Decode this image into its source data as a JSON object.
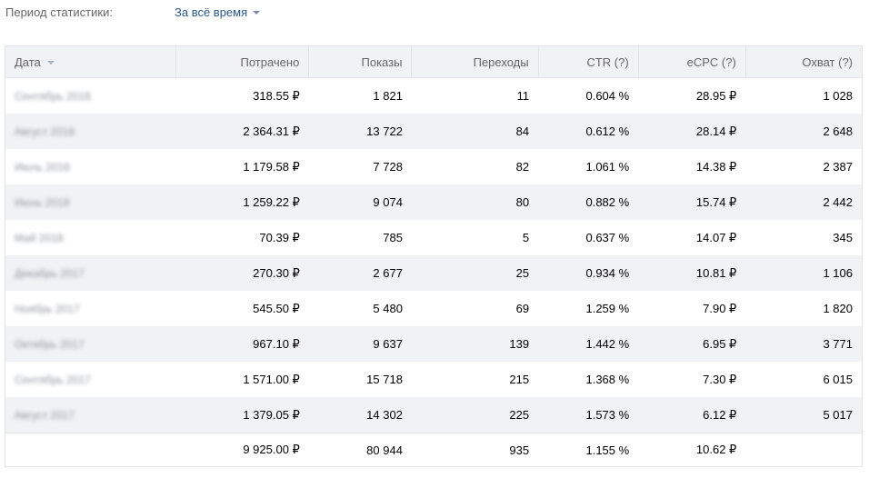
{
  "period": {
    "label": "Период статистики:",
    "value": "За всё время"
  },
  "table": {
    "columns": {
      "date": "Дата",
      "spent": "Потрачено",
      "impressions": "Показы",
      "clicks": "Переходы",
      "ctr": "CTR (?)",
      "ecpc": "eCPC (?)",
      "reach": "Охват (?)"
    },
    "rows": [
      {
        "date": "Сентябрь 2018",
        "spent": "318.55 ₽",
        "impressions": "1 821",
        "clicks": "11",
        "ctr": "0.604 %",
        "ecpc": "28.95 ₽",
        "reach": "1 028"
      },
      {
        "date": "Август 2018",
        "spent": "2 364.31 ₽",
        "impressions": "13 722",
        "clicks": "84",
        "ctr": "0.612 %",
        "ecpc": "28.14 ₽",
        "reach": "2 648"
      },
      {
        "date": "Июль 2018",
        "spent": "1 179.58 ₽",
        "impressions": "7 728",
        "clicks": "82",
        "ctr": "1.061 %",
        "ecpc": "14.38 ₽",
        "reach": "2 387"
      },
      {
        "date": "Июнь 2018",
        "spent": "1 259.22 ₽",
        "impressions": "9 074",
        "clicks": "80",
        "ctr": "0.882 %",
        "ecpc": "15.74 ₽",
        "reach": "2 442"
      },
      {
        "date": "Май 2018",
        "spent": "70.39 ₽",
        "impressions": "785",
        "clicks": "5",
        "ctr": "0.637 %",
        "ecpc": "14.07 ₽",
        "reach": "345"
      },
      {
        "date": "Декабрь 2017",
        "spent": "270.30 ₽",
        "impressions": "2 677",
        "clicks": "25",
        "ctr": "0.934 %",
        "ecpc": "10.81 ₽",
        "reach": "1 106"
      },
      {
        "date": "Ноябрь 2017",
        "spent": "545.50 ₽",
        "impressions": "5 480",
        "clicks": "69",
        "ctr": "1.259 %",
        "ecpc": "7.90 ₽",
        "reach": "1 820"
      },
      {
        "date": "Октябрь 2017",
        "spent": "967.10 ₽",
        "impressions": "9 637",
        "clicks": "139",
        "ctr": "1.442 %",
        "ecpc": "6.95 ₽",
        "reach": "3 771"
      },
      {
        "date": "Сентябрь 2017",
        "spent": "1 571.00 ₽",
        "impressions": "15 718",
        "clicks": "215",
        "ctr": "1.368 %",
        "ecpc": "7.30 ₽",
        "reach": "6 015"
      },
      {
        "date": "Август 2017",
        "spent": "1 379.05 ₽",
        "impressions": "14 302",
        "clicks": "225",
        "ctr": "1.573 %",
        "ecpc": "6.12 ₽",
        "reach": "5 017"
      }
    ],
    "total": {
      "spent": "9 925.00 ₽",
      "impressions": "80 944",
      "clicks": "935",
      "ctr": "1.155 %",
      "ecpc": "10.62 ₽"
    }
  },
  "colors": {
    "link": "#2a5885",
    "header_bg": "#f0f2f5",
    "stripe_bg": "#f0f2f5",
    "border": "#e3e4e8",
    "muted_text": "#656565"
  }
}
